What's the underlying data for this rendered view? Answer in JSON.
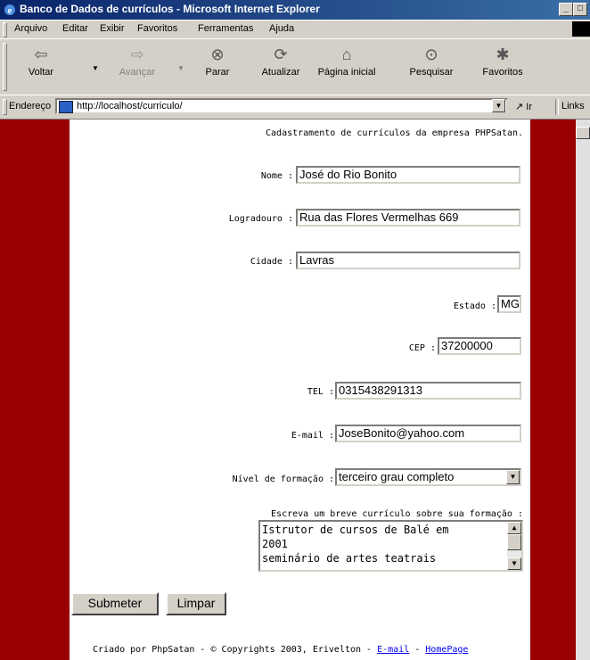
{
  "window": {
    "title": "Banco de Dados de currículos - Microsoft Internet Explorer",
    "minimize": "_",
    "maximize": "□",
    "close": "×"
  },
  "menu": {
    "items": [
      "Arquivo",
      "Editar",
      "Exibir",
      "Favoritos",
      "Ferramentas",
      "Ajuda"
    ]
  },
  "toolbar": {
    "back": "Voltar",
    "forward": "Avançar",
    "stop": "Parar",
    "refresh": "Atualizar",
    "home": "Página inicial",
    "search": "Pesquisar",
    "favorites": "Favoritos"
  },
  "address": {
    "label": "Endereço",
    "url": "http://localhost/curriculo/",
    "go": "Ir",
    "links": "Links"
  },
  "page": {
    "header": "Cadastramento de currículos da empresa PHPSatan.",
    "fields": {
      "nome_label": "Nome :",
      "nome_value": "José do Rio Bonito",
      "logradouro_label": "Logradouro :",
      "logradouro_value": "Rua das Flores Vermelhas 669",
      "cidade_label": "Cidade :",
      "cidade_value": "Lavras",
      "estado_label": "Estado :",
      "estado_value": "MG",
      "cep_label": "CEP :",
      "cep_value": "37200000",
      "tel_label": "TEL :",
      "tel_value": "0315438291313",
      "email_label": "E-mail :",
      "email_value": "JoseBonito@yahoo.com",
      "formacao_label": "Nível de formação :",
      "formacao_value": "terceiro grau completo",
      "curriculo_label": "Escreva um breve currículo sobre sua formação :",
      "curriculo_lines": [
        "Istrutor de cursos de Balé em",
        "2001",
        "seminário de artes teatrais"
      ]
    },
    "buttons": {
      "submit": "Submeter",
      "reset": "Limpar"
    },
    "footer": {
      "text": "Criado por PhpSatan - © Copyrights 2003, Erivelton - ",
      "email_link": "E-mail",
      "separator": " - ",
      "home_link": "HomePage"
    }
  }
}
